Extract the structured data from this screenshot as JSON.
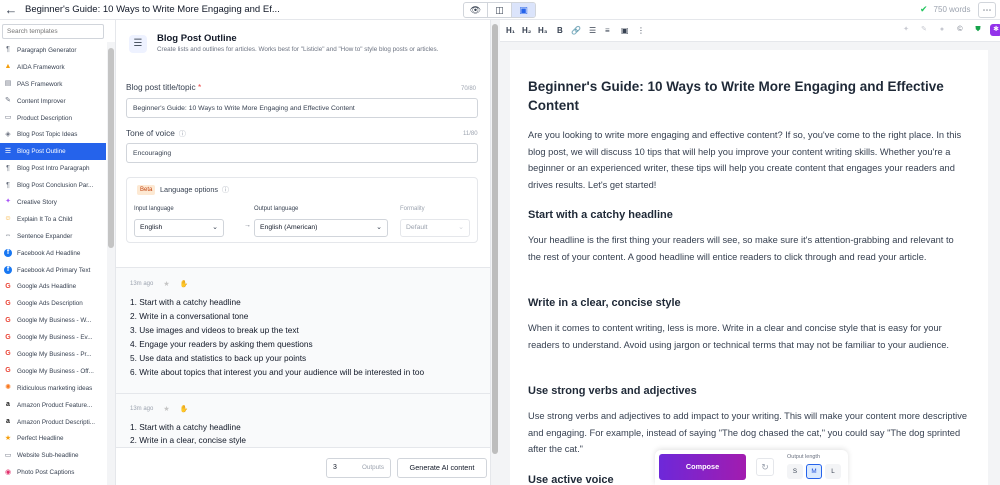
{
  "topbar": {
    "back_icon": "arrow-left-icon",
    "doc_title": "Beginner's Guide: 10 Ways to Write More Engaging and Ef...",
    "view_modes": [
      "👁",
      "◫",
      "▣"
    ],
    "save_status": "750 words"
  },
  "sidebar": {
    "search_placeholder": "Search templates",
    "items": [
      {
        "label": "Paragraph Generator",
        "icon": "¶"
      },
      {
        "label": "AIDA Framework",
        "icon": "▲"
      },
      {
        "label": "PAS Framework",
        "icon": "▤"
      },
      {
        "label": "Content Improver",
        "icon": "✎"
      },
      {
        "label": "Product Description",
        "icon": "▭"
      },
      {
        "label": "Blog Post Topic Ideas",
        "icon": "◈"
      },
      {
        "label": "Blog Post Outline",
        "icon": "☰"
      },
      {
        "label": "Blog Post Intro Paragraph",
        "icon": "¶"
      },
      {
        "label": "Blog Post Conclusion Par...",
        "icon": "¶"
      },
      {
        "label": "Creative Story",
        "icon": "✦"
      },
      {
        "label": "Explain It To a Child",
        "icon": "☺"
      },
      {
        "label": "Sentence Expander",
        "icon": "⇔"
      },
      {
        "label": "Facebook Ad Headline",
        "icon": "f"
      },
      {
        "label": "Facebook Ad Primary Text",
        "icon": "f"
      },
      {
        "label": "Google Ads Headline",
        "icon": "G"
      },
      {
        "label": "Google Ads Description",
        "icon": "G"
      },
      {
        "label": "Google My Business - W...",
        "icon": "G"
      },
      {
        "label": "Google My Business - Ev...",
        "icon": "G"
      },
      {
        "label": "Google My Business - Pr...",
        "icon": "G"
      },
      {
        "label": "Google My Business - Off...",
        "icon": "G"
      },
      {
        "label": "Ridiculous marketing ideas",
        "icon": "✺"
      },
      {
        "label": "Amazon Product Feature...",
        "icon": "a"
      },
      {
        "label": "Amazon Product Descripti...",
        "icon": "a"
      },
      {
        "label": "Perfect Headline",
        "icon": "★"
      },
      {
        "label": "Website Sub-headline",
        "icon": "▭"
      },
      {
        "label": "Photo Post Captions",
        "icon": "◉"
      }
    ]
  },
  "form": {
    "tool_title": "Blog Post Outline",
    "tool_desc": "Create lists and outlines for articles. Works best for \"Listicle\" and \"How to\" style blog posts or articles.",
    "title_label": "Blog post title/topic",
    "title_required": "*",
    "title_count": "70/80",
    "title_value": "Beginner's Guide: 10 Ways to Write More Engaging and Effective Content",
    "tone_label": "Tone of voice",
    "tone_count": "11/80",
    "tone_value": "Encouraging",
    "lang": {
      "beta": "Beta",
      "title": "Language options",
      "input_label": "Input language",
      "input_value": "English",
      "output_label": "Output language",
      "output_value": "English (American)",
      "formality_label": "Formality",
      "formality_value": "Default"
    }
  },
  "outputs": [
    {
      "time": "13m ago",
      "lines": [
        "1. Start with a catchy headline",
        "2. Write in a conversational tone",
        "3. Use images and videos to break up the text",
        "4. Engage your readers by asking them questions",
        "5. Use data and statistics to back up your points",
        "6. Write about topics that interest you and your audience will be interested in too"
      ]
    },
    {
      "time": "13m ago",
      "lines": [
        "1. Start with a catchy headline",
        "2. Write in a clear, concise style"
      ]
    }
  ],
  "generate": {
    "count": "3",
    "count_label": "Outputs",
    "button": "Generate AI content"
  },
  "toolbar": {
    "h1": "H₁",
    "h2": "H₂",
    "h3": "H₃",
    "bold": "B",
    "link": "🔗",
    "ul": "☰",
    "ol": "≡",
    "image": "▣",
    "more": "⋮"
  },
  "editor": {
    "title": "Beginner's Guide: 10 Ways to Write More Engaging and Effective Content",
    "intro": "Are you looking to write more engaging and effective content? If so, you've come to the right place. In this blog post, we will discuss 10 tips that will help you improve your content writing skills. Whether you're a beginner or an experienced writer, these tips will help you create content that engages your readers and drives results. Let's get started!",
    "sections": [
      {
        "heading": "Start with a catchy headline",
        "body": "Your headline is the first thing your readers will see, so make sure it's attention-grabbing and relevant to the rest of your content. A good headline will entice readers to click through and read your article."
      },
      {
        "heading": "Write in a clear, concise style",
        "body": "When it comes to content writing, less is more. Write in a clear and concise style that is easy for your readers to understand. Avoid using jargon or technical terms that may not be familiar to your audience."
      },
      {
        "heading": "Use strong verbs and adjectives",
        "body": "Use strong verbs and adjectives to add impact to your writing. This will make your content more descriptive and engaging. For example, instead of saying \"The dog chased the cat,\" you could say \"The dog sprinted after the cat.\""
      },
      {
        "heading": "Use active voice",
        "body": ""
      }
    ]
  },
  "composer": {
    "compose": "Compose",
    "length_label": "Output length",
    "lengths": [
      "S",
      "M",
      "L"
    ],
    "active_length": "M"
  },
  "colors": {
    "accent": "#2563eb",
    "compose_gradient_start": "#6d28d9",
    "compose_gradient_end": "#a21caf"
  }
}
